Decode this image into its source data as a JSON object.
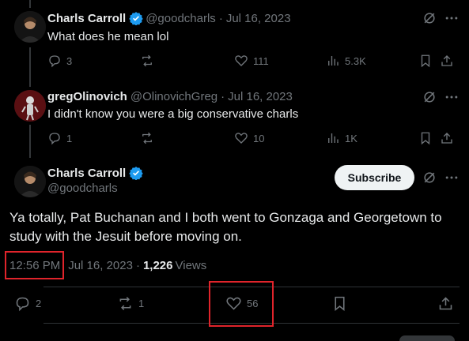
{
  "replies": [
    {
      "name": "Charls Carroll",
      "handle": "@goodcharls",
      "separator": "·",
      "date": "Jul 16, 2023",
      "text": "What does he mean lol",
      "stats": {
        "replies": "3",
        "reposts": "",
        "likes": "111",
        "views": "5.3K"
      },
      "verified": true
    },
    {
      "name": "gregOlinovich",
      "handle": "@OlinovichGreg",
      "separator": "·",
      "date": "Jul 16, 2023",
      "text": "I didn't know you were a big conservative charls",
      "stats": {
        "replies": "1",
        "reposts": "",
        "likes": "10",
        "views": "1K"
      },
      "verified": false
    }
  ],
  "main_tweet": {
    "name": "Charls Carroll",
    "handle": "@goodcharls",
    "subscribe_label": "Subscribe",
    "text": "Ya totally, Pat Buchanan and I both went to Gonzaga and Georgetown to study with the Jesuit before moving on.",
    "time": "12:56 PM",
    "date": "Jul 16, 2023",
    "separator": "·",
    "views_count": "1,226",
    "views_label": "Views",
    "stats": {
      "replies": "2",
      "reposts": "1",
      "likes": "56"
    }
  },
  "colors": {
    "accent": "#1d9bf0",
    "highlight_box": "#e0242b",
    "muted": "#71767b",
    "background": "#000000"
  }
}
